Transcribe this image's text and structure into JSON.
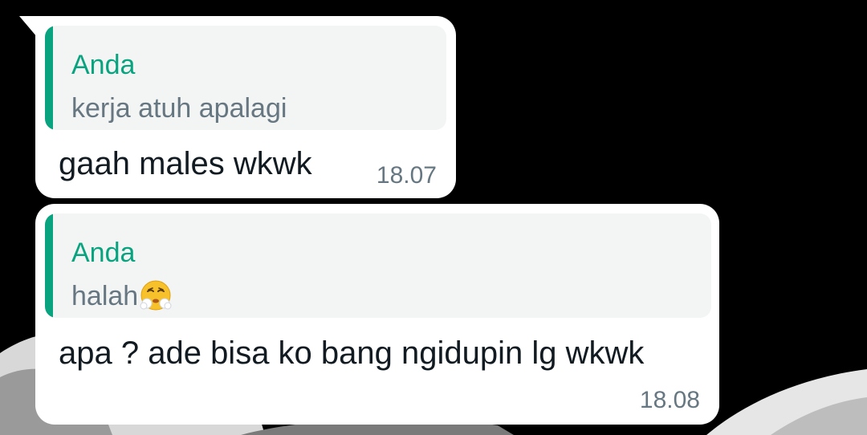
{
  "colors": {
    "accent": "#0aa37f",
    "bubble": "#ffffff",
    "quote_bg": "#f3f4f4",
    "text": "#111b21",
    "muted": "#667781",
    "background": "#000000"
  },
  "messages": [
    {
      "quote": {
        "author": "Anda",
        "text": "kerja atuh apalagi"
      },
      "text": "gaah males wkwk",
      "time": "18.07"
    },
    {
      "quote": {
        "author": "Anda",
        "text": "halah",
        "emoji": "face-with-steam-from-nose-emoji"
      },
      "text": "apa ? ade bisa ko bang ngidupin lg wkwk",
      "time": "18.08"
    }
  ]
}
